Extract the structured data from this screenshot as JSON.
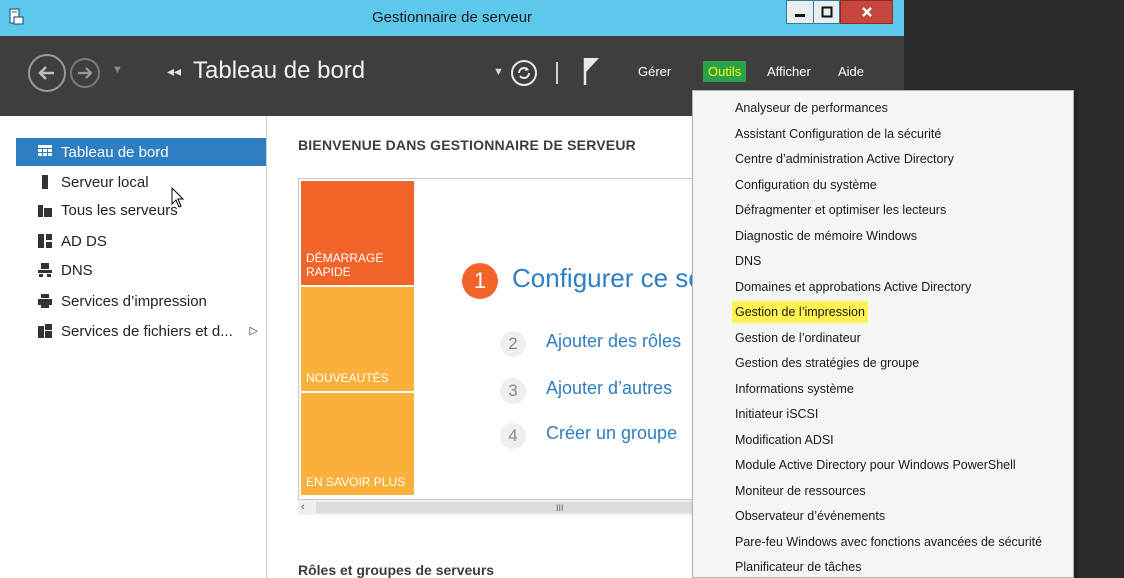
{
  "window": {
    "title": "Gestionnaire de serveur"
  },
  "toolbar": {
    "breadcrumb_arrows": "◂◂",
    "breadcrumb_title": "Tableau de bord",
    "menus": {
      "gerer": "Gérer",
      "outils": "Outils",
      "afficher": "Afficher",
      "aide": "Aide"
    }
  },
  "sidebar": {
    "items": [
      {
        "label": "Tableau de bord",
        "icon": "dashboard-icon"
      },
      {
        "label": "Serveur local",
        "icon": "server-icon"
      },
      {
        "label": "Tous les serveurs",
        "icon": "servers-icon"
      },
      {
        "label": "AD DS",
        "icon": "adds-icon"
      },
      {
        "label": "DNS",
        "icon": "dns-icon"
      },
      {
        "label": "Services d’impression",
        "icon": "printer-icon"
      },
      {
        "label": "Services de fichiers et d...",
        "icon": "file-services-icon"
      }
    ]
  },
  "main": {
    "welcome_title": "BIENVENUE DANS GESTIONNAIRE DE SERVEUR",
    "tiles": [
      "DÉMARRAGE\nRAPIDE",
      "NOUVEAUTÉS",
      "EN SAVOIR PLUS"
    ],
    "step1_number": "1",
    "step1_label": "Configurer ce se",
    "steps": [
      {
        "number": "2",
        "label": "Ajouter des rôles"
      },
      {
        "number": "3",
        "label": "Ajouter d’autres"
      },
      {
        "number": "4",
        "label": "Créer un groupe"
      }
    ],
    "scroll_grip": "III",
    "roles_title": "Rôles et groupes de serveurs"
  },
  "outils_menu": {
    "items": [
      "Analyseur de performances",
      "Assistant Configuration de la sécurité",
      "Centre d’administration Active Directory",
      "Configuration du système",
      "Défragmenter et optimiser les lecteurs",
      "Diagnostic de mémoire Windows",
      "DNS",
      "Domaines et approbations Active Directory",
      "Gestion de l’impression",
      "Gestion de l’ordinateur",
      "Gestion des stratégies de groupe",
      "Informations système",
      "Initiateur iSCSI",
      "Modification ADSI",
      "Module Active Directory pour Windows PowerShell",
      "Moniteur de ressources",
      "Observateur d’événements",
      "Pare-feu Windows avec fonctions avancées de sécurité",
      "Planificateur de tâches"
    ],
    "highlighted": "Gestion de l’impression"
  },
  "colors": {
    "titlebar": "#5cc8ec",
    "toolbar": "#3e3e3e",
    "accent": "#2e7ec4",
    "tile_orange": "#f2652a",
    "tile_yellow": "#fbb03b",
    "outils_bg": "#2aa24a",
    "highlight": "#fff44f"
  }
}
